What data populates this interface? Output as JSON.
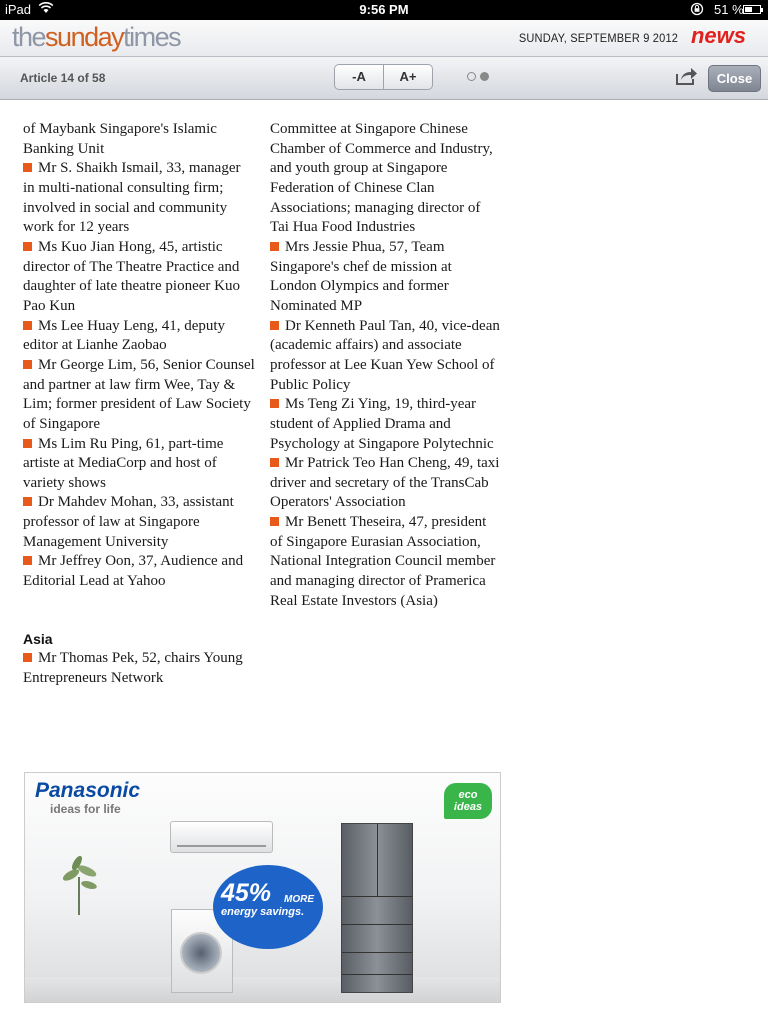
{
  "status_bar": {
    "device": "iPad",
    "time": "9:56 PM",
    "battery_text": "51 %",
    "battery_level": 0.51
  },
  "masthead": {
    "logo_the": "the",
    "logo_sunday": "sunday",
    "logo_times": "times",
    "date": "SUNDAY, SEPTEMBER 9 2012",
    "section": "news"
  },
  "toolbar": {
    "article_count": "Article 14 of 58",
    "font_decrease": "-A",
    "font_increase": "A+",
    "close_label": "Close",
    "page_dots": 2,
    "active_dot": 2
  },
  "article": {
    "left_intro": "of Maybank Singapore's Islamic Banking Unit",
    "left_entries": [
      "Mr S. Shaikh Ismail, 33, manager in multi-national consulting firm; involved in social and community work for 12 years",
      "Ms Kuo Jian Hong, 45, artistic director of The Theatre Practice and daughter of late theatre pioneer Kuo Pao Kun",
      "Ms Lee Huay Leng, 41, deputy editor at Lianhe Zaobao",
      "Mr George Lim, 56, Senior Counsel and partner at law firm Wee, Tay & Lim; former president of Law Society of Singapore",
      "Ms Lim Ru Ping, 61, part-time artiste at MediaCorp and host of variety shows",
      "Dr Mahdev Mohan, 33, assistant professor of law at Singapore Management University",
      "Mr Jeffrey Oon, 37, Audience and Editorial Lead at Yahoo"
    ],
    "subhead": "Asia",
    "asia_entries": [
      "Mr Thomas Pek, 52, chairs Young Entrepreneurs Network"
    ],
    "right_intro": "Committee at Singapore Chinese Chamber of Commerce and Industry, and youth group at Singapore Federation of Chinese Clan Associations; managing director of Tai Hua Food Industries",
    "right_entries": [
      "Mrs Jessie Phua, 57, Team Singapore's chef de mission at London Olympics and former Nominated MP",
      "Dr Kenneth Paul Tan, 40, vice-dean (academic affairs) and associate professor at Lee Kuan Yew School of Public Policy",
      "Ms Teng Zi Ying, 19, third-year student of Applied Drama and Psychology at Singapore Polytechnic",
      "Mr Patrick Teo Han Cheng, 49, taxi driver and secretary of the TransCab Operators' Association",
      "Mr Benett Theseira, 47, president of Singapore Eurasian Association, National Integration Council member and managing director of Pramerica Real Estate Investors (Asia)"
    ]
  },
  "ad": {
    "brand": "Panasonic",
    "tagline": "ideas for life",
    "eco_line1": "eco",
    "eco_line2": "ideas",
    "savings_pct": "45%",
    "savings_more": "MORE",
    "savings_text": "energy savings."
  },
  "colors": {
    "bullet": "#e8591c",
    "section": "#e0211d",
    "brand_blue": "#0a4aa3",
    "eco_green": "#3ab54a"
  }
}
